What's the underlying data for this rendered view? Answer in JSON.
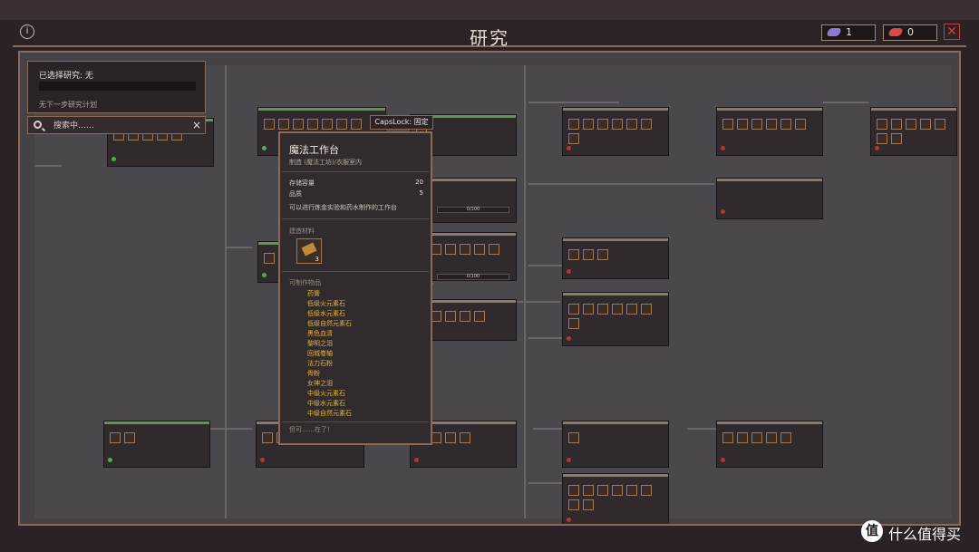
{
  "window": {
    "title": "研究"
  },
  "resources": [
    {
      "value": "1",
      "color": "#8e7ad6"
    },
    {
      "value": "0",
      "color": "#d64a4a"
    }
  ],
  "selected_research": {
    "label": "已选择研究: 无",
    "next": "无下一步研究计划"
  },
  "search": {
    "placeholder": "搜索中……",
    "clear": "×"
  },
  "capslock": "CapsLock: 固定",
  "tooltip": {
    "title": "魔法工作台",
    "subtitle": "制造 (魔法工坊)/衣服室内",
    "stats": [
      {
        "label": "存储容量",
        "value": "20"
      },
      {
        "label": "品质",
        "value": "5"
      }
    ],
    "description": "可以进行炼金实验和药水制作的工作台",
    "materials_label": "建造材料",
    "material_count": "3",
    "products_label": "可制作物品",
    "products": [
      "药膏",
      "低级火元素石",
      "低级水元素石",
      "低级自然元素石",
      "黑色血清",
      "黎明之泪",
      "回城卷轴",
      "法力石粉",
      "骨粉",
      "女神之泪",
      "中级火元素石",
      "中级水元素石",
      "中级自然元素石"
    ],
    "footer": "但可……在了!"
  },
  "progress": [
    "0/100",
    "0/100"
  ],
  "watermark": {
    "logo": "值",
    "text": "什么值得买"
  }
}
